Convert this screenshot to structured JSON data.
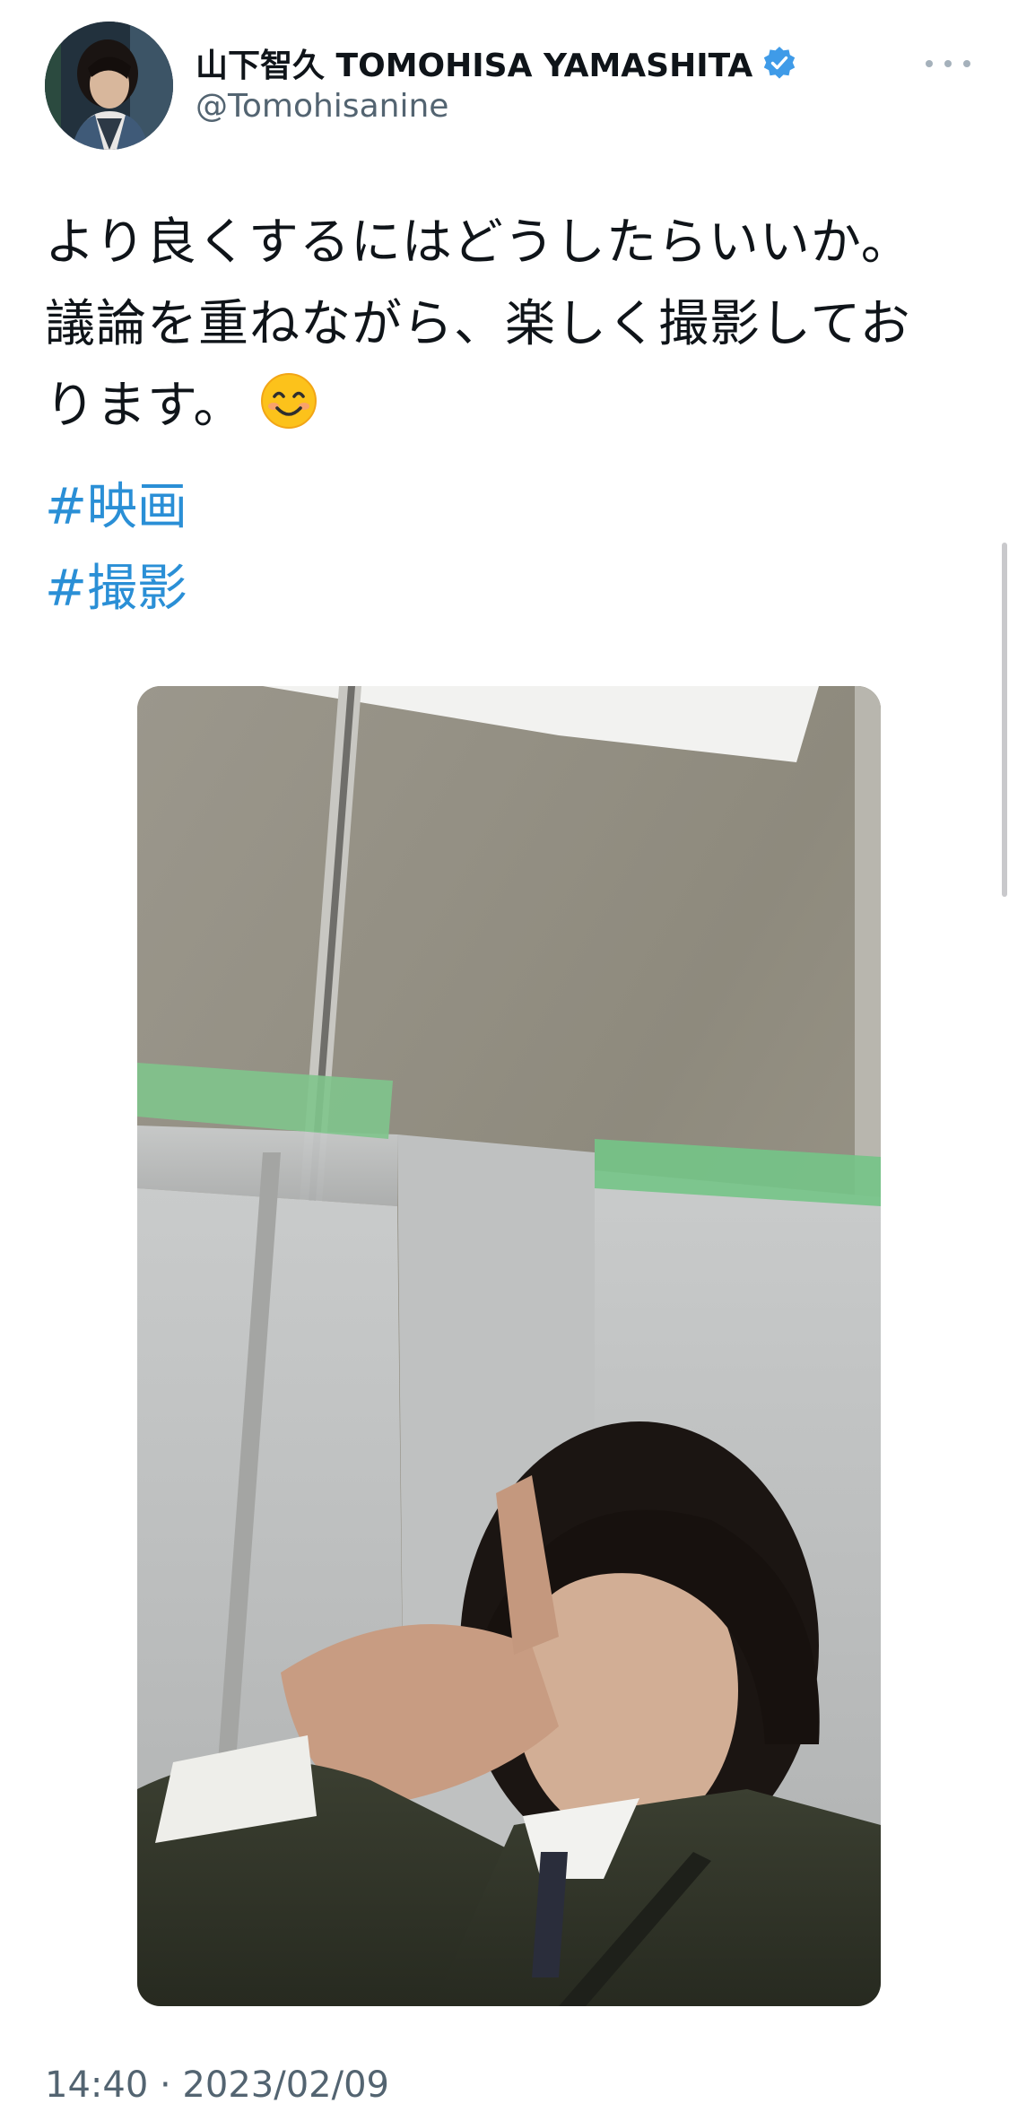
{
  "author": {
    "display_name": "山下智久 TOMOHISA YAMASHITA",
    "handle": "@Tomohisanine",
    "verified": true,
    "verified_badge_color": "#1d9bf0"
  },
  "menu": {
    "more_icon": "more-horizontal-icon"
  },
  "tweet": {
    "lines": [
      "より良くするにはどうしたらいいか。",
      "議論を重ねながら、楽しく撮影してお",
      "ります。"
    ],
    "emoji": "smiling-face-icon",
    "hashtags": [
      "#映画",
      "#撮影"
    ]
  },
  "media": {
    "kind": "photo",
    "subject": "selfie photo"
  },
  "timestamp": "14:40 · 2023/02/09",
  "colors": {
    "text": "#0f1419",
    "secondary": "#536471",
    "link": "#2a8fd6",
    "background": "#ffffff"
  }
}
